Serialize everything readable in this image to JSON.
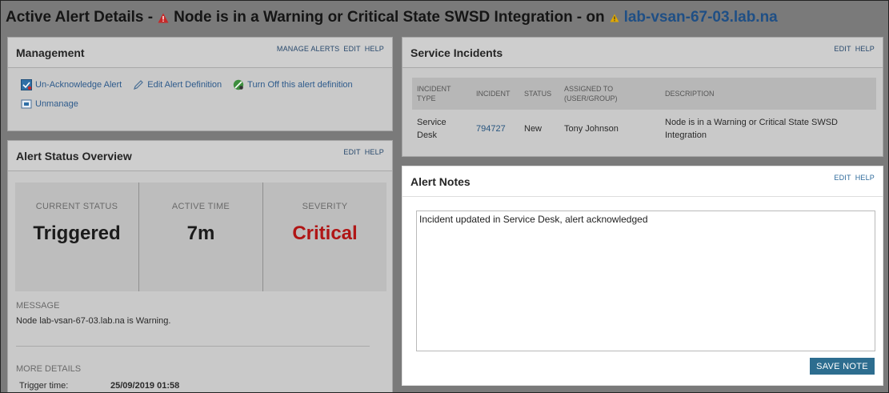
{
  "page": {
    "title_prefix": "Active Alert Details -",
    "title_alert": "Node is in a Warning or Critical State SWSD Integration",
    "title_on": "- on",
    "title_node": "lab-vsan-67-03.lab.na"
  },
  "management": {
    "title": "Management",
    "links": {
      "manage_alerts": "MANAGE ALERTS",
      "edit": "EDIT",
      "help": "HELP"
    },
    "actions": {
      "unack": "Un-Acknowledge Alert",
      "edit_def": "Edit Alert Definition",
      "turn_off": "Turn Off this alert definition",
      "unmanage": "Unmanage"
    }
  },
  "status": {
    "title": "Alert Status Overview",
    "links": {
      "edit": "EDIT",
      "help": "HELP"
    },
    "current_status_label": "CURRENT STATUS",
    "current_status": "Triggered",
    "active_time_label": "ACTIVE TIME",
    "active_time": "7m",
    "severity_label": "SEVERITY",
    "severity": "Critical",
    "message_label": "MESSAGE",
    "message": "Node lab-vsan-67-03.lab.na is Warning.",
    "more_details_label": "MORE DETAILS",
    "trigger_time_label": "Trigger time:",
    "trigger_time": "25/09/2019 01:58"
  },
  "incidents": {
    "title": "Service Incidents",
    "links": {
      "edit": "EDIT",
      "help": "HELP"
    },
    "headers": {
      "type_l1": "INCIDENT",
      "type_l2": "TYPE",
      "incident": "INCIDENT",
      "status": "STATUS",
      "assigned_l1": "ASSIGNED TO",
      "assigned_l2": "(USER/GROUP)",
      "description": "DESCRIPTION"
    },
    "rows": [
      {
        "type_l1": "Service",
        "type_l2": "Desk",
        "incident": "794727",
        "status": "New",
        "assigned": "Tony Johnson",
        "desc_l1": "Node is in a Warning or Critical State SWSD",
        "desc_l2": "Integration"
      }
    ]
  },
  "notes": {
    "title": "Alert Notes",
    "links": {
      "edit": "EDIT",
      "help": "HELP"
    },
    "text": "Incident updated in Service Desk, alert acknowledged",
    "save_label": "SAVE NOTE"
  },
  "colors": {
    "link": "#1f4f85",
    "critical": "#b01515",
    "save_button": "#2d6d8f",
    "warning_icon": "#c62828"
  },
  "icons": [
    "warning-triangle-icon",
    "small-warning-icon",
    "unacknowledge-icon",
    "pencil-icon",
    "turn-off-icon",
    "unmanage-icon"
  ]
}
